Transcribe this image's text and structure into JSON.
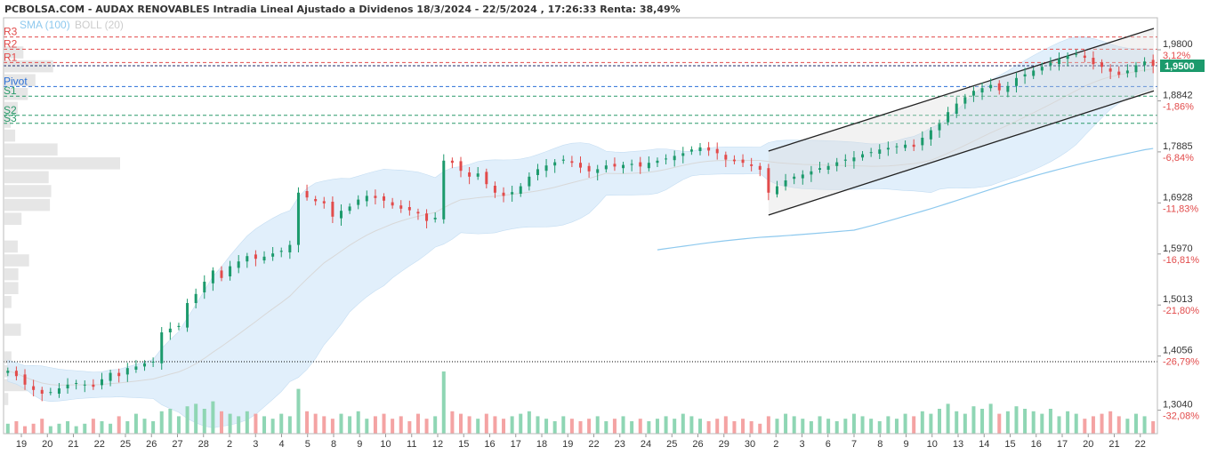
{
  "chart_data": {
    "type": "candlestick",
    "title": "PCBOLSA.COM - AUDAX RENOVABLES Intradia Lineal Ajustado a Dividenos 18/3/2024 - 22/5/2024 , 17:26:33 Renta: 38,49%",
    "legend": [
      {
        "name": "SMA (100)",
        "color": "#8ec9ee"
      },
      {
        "name": "BOLL (20)",
        "color": "#cccccc"
      }
    ],
    "ylim": [
      1.26,
      2.04
    ],
    "yticks": [
      {
        "value": 1.98,
        "label": "1,9800",
        "pct": "3,12%"
      },
      {
        "value": 1.8842,
        "label": "1,8842",
        "pct": "-1,86%"
      },
      {
        "value": 1.7885,
        "label": "1,7885",
        "pct": "-6,84%"
      },
      {
        "value": 1.6928,
        "label": "1,6928",
        "pct": "-11,83%"
      },
      {
        "value": 1.597,
        "label": "1,5970",
        "pct": "-16,81%"
      },
      {
        "value": 1.5013,
        "label": "1,5013",
        "pct": "-21,80%"
      },
      {
        "value": 1.4056,
        "label": "1,4056",
        "pct": "-26,79%"
      },
      {
        "value": 1.304,
        "label": "1,3040",
        "pct": "-32,08%"
      }
    ],
    "last_price": {
      "value": 1.95,
      "label": "1,9500",
      "color": "#1c9a6c"
    },
    "reference_line": 1.395,
    "levels": [
      {
        "name": "R3",
        "value": 2.004,
        "kind": "r"
      },
      {
        "name": "R2",
        "value": 1.981,
        "kind": "r"
      },
      {
        "name": "R1",
        "value": 1.956,
        "kind": "r"
      },
      {
        "name": "Pivot",
        "value": 1.911,
        "kind": "p"
      },
      {
        "name": "S1",
        "value": 1.893,
        "kind": "s"
      },
      {
        "name": "S2",
        "value": 1.857,
        "kind": "s"
      },
      {
        "name": "S3",
        "value": 1.842,
        "kind": "s"
      }
    ],
    "x_labels": [
      "19",
      "20",
      "21",
      "22",
      "25",
      "26",
      "27",
      "28",
      "2",
      "3",
      "4",
      "5",
      "8",
      "9",
      "10",
      "11",
      "12",
      "15",
      "16",
      "17",
      "18",
      "19",
      "22",
      "23",
      "24",
      "25",
      "26",
      "29",
      "30",
      "2",
      "3",
      "6",
      "7",
      "8",
      "9",
      "10",
      "13",
      "14",
      "15",
      "16",
      "17",
      "20",
      "21",
      "22"
    ],
    "channel": {
      "upper": [
        1.79,
        2.02
      ],
      "lower": [
        1.67,
        1.903
      ],
      "start_label_index": 29
    },
    "closes": [
      1.378,
      1.368,
      1.352,
      1.342,
      1.335,
      1.338,
      1.345,
      1.352,
      1.355,
      1.352,
      1.348,
      1.362,
      1.374,
      1.368,
      1.383,
      1.386,
      1.392,
      1.395,
      1.45,
      1.457,
      1.462,
      1.505,
      1.522,
      1.545,
      1.566,
      1.552,
      1.574,
      1.583,
      1.593,
      1.588,
      1.592,
      1.598,
      1.603,
      1.614,
      1.712,
      1.703,
      1.696,
      1.692,
      1.667,
      1.678,
      1.686,
      1.699,
      1.706,
      1.702,
      1.697,
      1.688,
      1.682,
      1.679,
      1.673,
      1.659,
      1.665,
      1.772,
      1.768,
      1.753,
      1.742,
      1.748,
      1.728,
      1.712,
      1.706,
      1.713,
      1.724,
      1.742,
      1.756,
      1.763,
      1.769,
      1.774,
      1.768,
      1.759,
      1.752,
      1.756,
      1.763,
      1.761,
      1.764,
      1.766,
      1.761,
      1.768,
      1.772,
      1.776,
      1.781,
      1.786,
      1.793,
      1.797,
      1.791,
      1.786,
      1.774,
      1.771,
      1.768,
      1.762,
      1.755,
      1.712,
      1.724,
      1.735,
      1.742,
      1.746,
      1.752,
      1.758,
      1.762,
      1.769,
      1.774,
      1.778,
      1.784,
      1.788,
      1.793,
      1.796,
      1.799,
      1.802,
      1.798,
      1.815,
      1.829,
      1.841,
      1.863,
      1.879,
      1.891,
      1.903,
      1.908,
      1.914,
      1.904,
      1.912,
      1.927,
      1.934,
      1.941,
      1.948,
      1.956,
      1.963,
      1.969,
      1.972,
      1.965,
      1.953,
      1.948,
      1.939,
      1.933,
      1.941,
      1.951,
      1.958,
      1.95
    ],
    "volumes": [
      4,
      5,
      3,
      4,
      6,
      3,
      4,
      5,
      3,
      4,
      6,
      5,
      4,
      7,
      5,
      8,
      6,
      5,
      9,
      10,
      7,
      11,
      12,
      10,
      13,
      9,
      8,
      7,
      9,
      8,
      7,
      6,
      8,
      7,
      18,
      9,
      8,
      7,
      6,
      8,
      7,
      9,
      6,
      7,
      8,
      6,
      7,
      5,
      8,
      6,
      7,
      25,
      9,
      8,
      7,
      6,
      8,
      7,
      6,
      7,
      8,
      9,
      7,
      6,
      5,
      7,
      6,
      5,
      6,
      7,
      5,
      6,
      7,
      5,
      6,
      5,
      6,
      7,
      6,
      8,
      7,
      6,
      5,
      6,
      7,
      5,
      6,
      5,
      4,
      7,
      6,
      8,
      7,
      6,
      5,
      7,
      6,
      5,
      6,
      8,
      7,
      6,
      5,
      7,
      6,
      8,
      7,
      9,
      8,
      10,
      12,
      9,
      8,
      11,
      10,
      12,
      8,
      9,
      11,
      10,
      9,
      8,
      10,
      7,
      9,
      8,
      6,
      7,
      8,
      9,
      7,
      6,
      8,
      7,
      5
    ]
  }
}
